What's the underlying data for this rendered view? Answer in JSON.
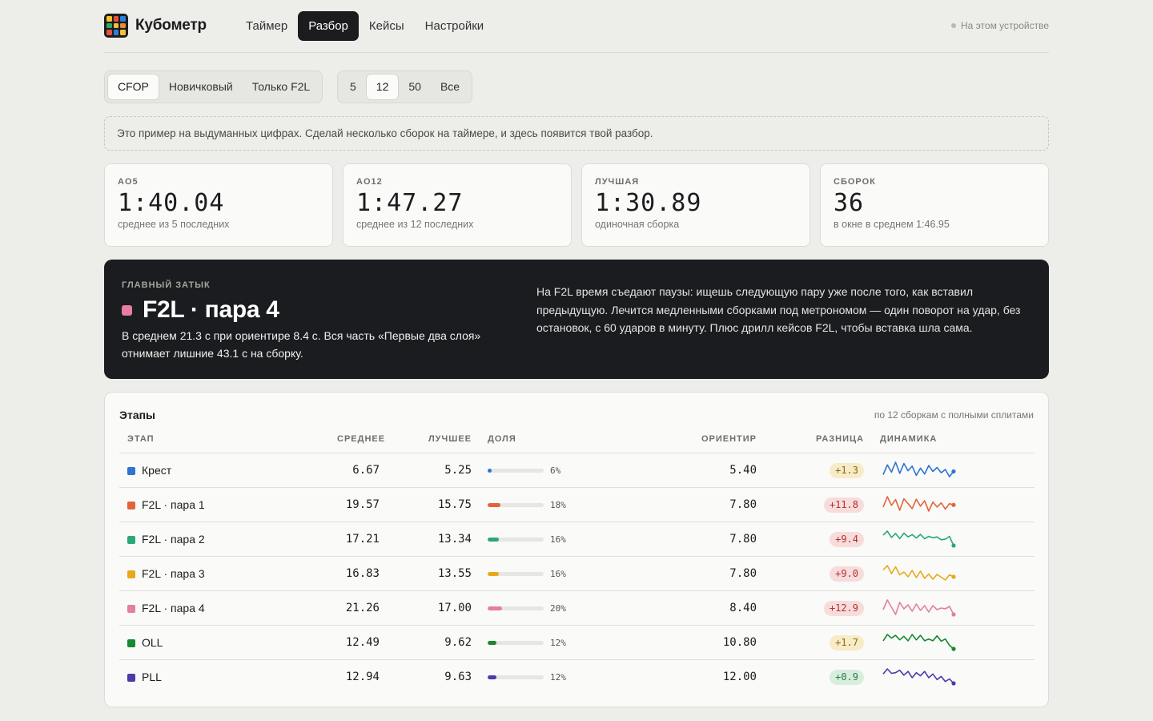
{
  "app": {
    "name": "Кубометр",
    "logo_colors": [
      "#f2c230",
      "#e5533c",
      "#2e7de0",
      "#2fa86a",
      "#f2c230",
      "#e98b2f",
      "#e5533c",
      "#2e7de0",
      "#f2c230"
    ]
  },
  "nav": {
    "items": [
      "Таймер",
      "Разбор",
      "Кейсы",
      "Настройки"
    ],
    "active": "Разбор"
  },
  "device": {
    "label": "На этом устройстве"
  },
  "filters": {
    "methods": [
      "CFOP",
      "Новичковый",
      "Только F2L"
    ],
    "method_active": "CFOP",
    "windows": [
      "5",
      "12",
      "50",
      "Все"
    ],
    "window_active": "12"
  },
  "notice": "Это пример на выдуманных цифрах. Сделай несколько сборок на таймере, и здесь появится твой разбор.",
  "stats": [
    {
      "label": "AO5",
      "value": "1:40.04",
      "sub": "среднее из 5 последних"
    },
    {
      "label": "AO12",
      "value": "1:47.27",
      "sub": "среднее из 12 последних"
    },
    {
      "label": "ЛУЧШАЯ",
      "value": "1:30.89",
      "sub": "одиночная сборка"
    },
    {
      "label": "СБОРОК",
      "value": "36",
      "sub": "в окне в среднем 1:46.95"
    }
  ],
  "bottleneck": {
    "label": "ГЛАВНЫЙ ЗАТЫК",
    "title": "F2L · пара 4",
    "color": "#e57ea0",
    "description": "В среднем 21.3 с при ориентире 8.4 с. Вся часть «Первые два слоя» отнимает лишние 43.1 с на сборку.",
    "advice": "На F2L время съедают паузы: ищешь следующую пару уже после того, как вставил предыдущую. Лечится медленными сборками под метрономом — один поворот на удар, без остановок, с 60 ударов в минуту. Плюс дрилл кейсов F2L, чтобы вставка шла сама."
  },
  "stages": {
    "title": "Этапы",
    "note": "по 12 сборкам с полными сплитами",
    "headers": {
      "stage": "ЭТАП",
      "average": "СРЕДНЕЕ",
      "best": "ЛУЧШЕЕ",
      "share": "ДОЛЯ",
      "target": "ОРИЕНТИР",
      "diff": "РАЗНИЦА",
      "trend": "ДИНАМИКА"
    },
    "rows": [
      {
        "name": "Крест",
        "color": "#2e74d0",
        "average": "6.67",
        "best": "5.25",
        "share": 6,
        "share_label": "6%",
        "target": "5.40",
        "diff": "+1.3",
        "severity": "low",
        "trend": [
          5.9,
          7.4,
          6.3,
          7.8,
          6.1,
          7.6,
          6.5,
          7.2,
          5.8,
          6.9,
          6.0,
          7.3,
          6.4,
          7.0,
          6.2,
          6.7,
          5.6,
          6.4
        ]
      },
      {
        "name": "F2L · пара 1",
        "color": "#e2643a",
        "average": "19.57",
        "best": "15.75",
        "share": 18,
        "share_label": "18%",
        "target": "7.80",
        "diff": "+11.8",
        "severity": "high",
        "trend": [
          19.0,
          21.5,
          19.4,
          20.8,
          18.2,
          21.0,
          19.8,
          18.6,
          20.9,
          19.2,
          20.5,
          18.0,
          20.2,
          19.0,
          20.0,
          18.5,
          19.8,
          19.5
        ]
      },
      {
        "name": "F2L · пара 2",
        "color": "#2aa876",
        "average": "17.21",
        "best": "13.34",
        "share": 16,
        "share_label": "16%",
        "target": "7.80",
        "diff": "+9.4",
        "severity": "high",
        "trend": [
          18.2,
          19.6,
          17.4,
          18.8,
          17.0,
          18.9,
          17.6,
          18.4,
          17.2,
          18.5,
          17.0,
          17.8,
          17.3,
          17.6,
          16.6,
          16.8,
          17.8,
          14.6
        ]
      },
      {
        "name": "F2L · пара 3",
        "color": "#e8a91a",
        "average": "16.83",
        "best": "13.55",
        "share": 16,
        "share_label": "16%",
        "target": "7.80",
        "diff": "+9.0",
        "severity": "high",
        "trend": [
          18.1,
          19.2,
          17.2,
          18.9,
          16.9,
          17.6,
          16.4,
          18.0,
          16.2,
          17.8,
          16.0,
          17.1,
          15.8,
          17.0,
          16.3,
          15.6,
          16.9,
          16.4
        ]
      },
      {
        "name": "F2L · пара 4",
        "color": "#e57ea0",
        "average": "21.26",
        "best": "17.00",
        "share": 20,
        "share_label": "20%",
        "target": "8.40",
        "diff": "+12.9",
        "severity": "high",
        "trend": [
          20.6,
          23.0,
          21.2,
          19.4,
          22.4,
          20.8,
          21.8,
          20.2,
          22.0,
          20.4,
          21.6,
          20.0,
          21.6,
          20.6,
          21.0,
          20.8,
          21.4,
          19.4
        ]
      },
      {
        "name": "OLL",
        "color": "#17892f",
        "average": "12.49",
        "best": "9.62",
        "share": 12,
        "share_label": "12%",
        "target": "10.80",
        "diff": "+1.7",
        "severity": "low",
        "trend": [
          12.6,
          14.0,
          13.2,
          13.8,
          12.8,
          13.6,
          12.6,
          14.0,
          12.8,
          13.8,
          12.6,
          13.0,
          12.6,
          13.7,
          12.5,
          13.0,
          11.6,
          10.8
        ]
      },
      {
        "name": "PLL",
        "color": "#4b3aa8",
        "average": "12.94",
        "best": "9.63",
        "share": 12,
        "share_label": "12%",
        "target": "12.00",
        "diff": "+0.9",
        "severity": "good",
        "trend": [
          13.8,
          14.6,
          13.9,
          14.0,
          14.4,
          13.6,
          14.2,
          13.2,
          14.0,
          13.5,
          14.2,
          13.2,
          13.8,
          12.9,
          13.4,
          12.6,
          13.0,
          12.3
        ]
      }
    ]
  }
}
